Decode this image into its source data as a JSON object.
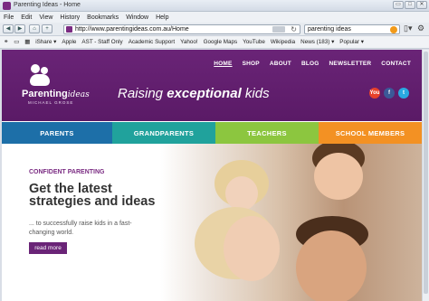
{
  "window": {
    "title": "Parenting Ideas - Home",
    "buttons": [
      "▭",
      "□",
      "✕"
    ]
  },
  "menu": [
    "File",
    "Edit",
    "View",
    "History",
    "Bookmarks",
    "Window",
    "Help"
  ],
  "nav": {
    "url": "http://www.parentingideas.com.au/Home",
    "search_query": "parenting ideas"
  },
  "bookmarks": [
    "iShare ▾",
    "Apple",
    "AST - Staff Only",
    "Academic Support",
    "Yahoo!",
    "Google Maps",
    "YouTube",
    "Wikipedia",
    "News (183) ▾",
    "Popular ▾"
  ],
  "site": {
    "topnav": [
      "HOME",
      "SHOP",
      "ABOUT",
      "BLOG",
      "NEWSLETTER",
      "CONTACT"
    ],
    "logo_main": "Parenting",
    "logo_italic": "ideas",
    "logo_sub": "MICHAEL GROSE",
    "tagline_pre": "Raising ",
    "tagline_bold": "exceptional",
    "tagline_post": " kids",
    "social": [
      "You",
      "f",
      "t"
    ],
    "tabs": [
      {
        "label": "PARENTS",
        "color": "#1d6fa8"
      },
      {
        "label": "GRANDPARENTS",
        "color": "#20a29c"
      },
      {
        "label": "TEACHERS",
        "color": "#8cc63f"
      },
      {
        "label": "SCHOOL MEMBERS",
        "color": "#f39123"
      }
    ],
    "hero": {
      "kicker": "CONFIDENT PARENTING",
      "headline": "Get the latest strategies and ideas",
      "sub": "... to successfully raise kids in a fast-changing world.",
      "button": "read more"
    }
  }
}
